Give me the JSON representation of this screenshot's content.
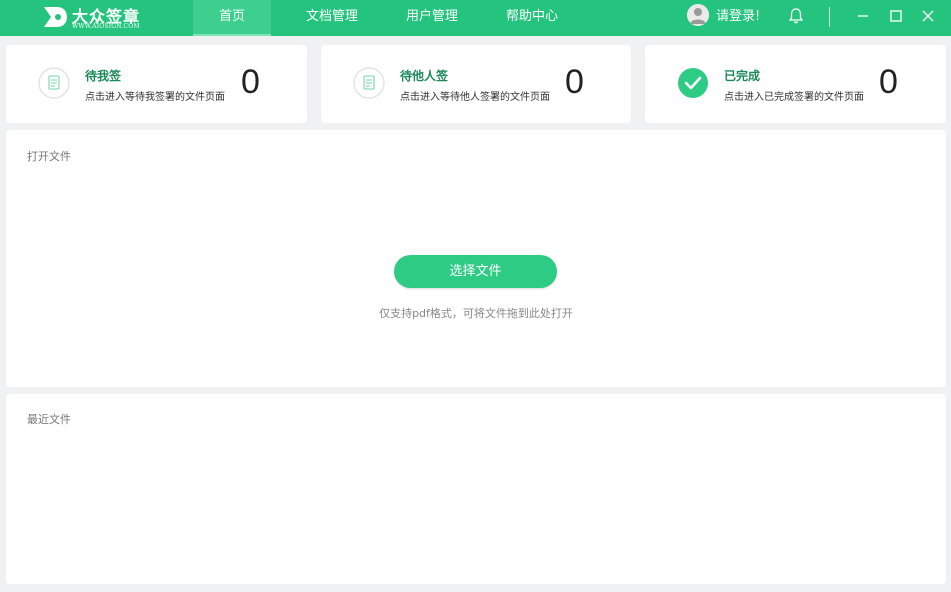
{
  "app": {
    "logo_text": "大众签章",
    "logo_sub": "WWW.AIOSIGN.COM",
    "accent": "#25c47e"
  },
  "nav": {
    "items": [
      {
        "label": "首页",
        "active": true
      },
      {
        "label": "文档管理",
        "active": false
      },
      {
        "label": "用户管理",
        "active": false
      },
      {
        "label": "帮助中心",
        "active": false
      }
    ]
  },
  "user": {
    "login_label": "请登录!",
    "avatar_icon": "user-avatar-icon"
  },
  "window_controls": [
    "bell-icon",
    "minimize-icon",
    "maximize-icon",
    "close-icon"
  ],
  "cards": [
    {
      "title": "待我签",
      "desc": "点击进入等待我签署的文件页面",
      "count": "0",
      "icon": "document-icon"
    },
    {
      "title": "待他人签",
      "desc": "点击进入等待他人签署的文件页面",
      "count": "0",
      "icon": "document-icon"
    },
    {
      "title": "已完成",
      "desc": "点击进入已完成签署的文件页面",
      "count": "0",
      "icon": "check-icon"
    }
  ],
  "open_file": {
    "title": "打开文件",
    "button_label": "选择文件",
    "hint": "仅支持pdf格式，可将文件拖到此处打开"
  },
  "recent": {
    "title": "最近文件"
  }
}
